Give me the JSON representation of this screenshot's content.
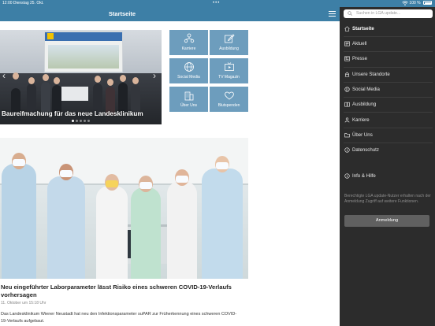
{
  "status_bar": {
    "time_date": "12:00  Dienstag 25. Okt.",
    "battery": "100 %"
  },
  "header": {
    "title": "Startseite"
  },
  "hero": {
    "caption": "Baureifmachung für das neue Landesklinikum"
  },
  "tiles": [
    {
      "label": "Karriere",
      "icon": "people-network-icon"
    },
    {
      "label": "Ausbildung",
      "icon": "pencil-square-icon"
    },
    {
      "label": "Social Media",
      "icon": "globe-icon"
    },
    {
      "label": "TV Magazin",
      "icon": "tv-icon"
    },
    {
      "label": "Über Uns",
      "icon": "building-icon"
    },
    {
      "label": "Blutspenden",
      "icon": "heart-icon"
    }
  ],
  "article": {
    "title": "Neu eingeführter Laborparameter lässt Risiko eines schweren COVID-19-Verlaufs vorhersagen",
    "date": "11. Oktober um 15:18 Uhr",
    "excerpt": "Das Landesklinikum Wiener Neustadt hat neu den Infektionsparameter suPAR zur Früherkennung eines schweren COVID-19-Verlaufs aufgebaut."
  },
  "sidebar": {
    "search_placeholder": "Suchen in LGA update...",
    "items": [
      {
        "label": "Startseite",
        "icon": "home-icon",
        "active": true
      },
      {
        "label": "Aktuell",
        "icon": "news-icon",
        "active": false
      },
      {
        "label": "Presse",
        "icon": "press-icon",
        "active": false
      },
      {
        "label": "Unsere Standorte",
        "icon": "location-icon",
        "active": false
      },
      {
        "label": "Social Media",
        "icon": "globe-icon",
        "active": false
      },
      {
        "label": "Ausbildung",
        "icon": "book-icon",
        "active": false
      },
      {
        "label": "Karriere",
        "icon": "person-icon",
        "active": false
      },
      {
        "label": "Über Uns",
        "icon": "folder-icon",
        "active": false
      },
      {
        "label": "Datenschutz",
        "icon": "info-icon",
        "active": false
      }
    ],
    "info_item": {
      "label": "Info & Hilfe",
      "icon": "info-icon"
    },
    "note": "Berechtigte LGA update-Nutzer erhalten nach der Anmeldung Zugriff auf weitere Funktionen.",
    "login_label": "Anmeldung"
  },
  "colors": {
    "header_blue": "#3d7fa6",
    "tile_blue": "#6d9dbd",
    "sidebar_bg": "#2c2c2c"
  }
}
